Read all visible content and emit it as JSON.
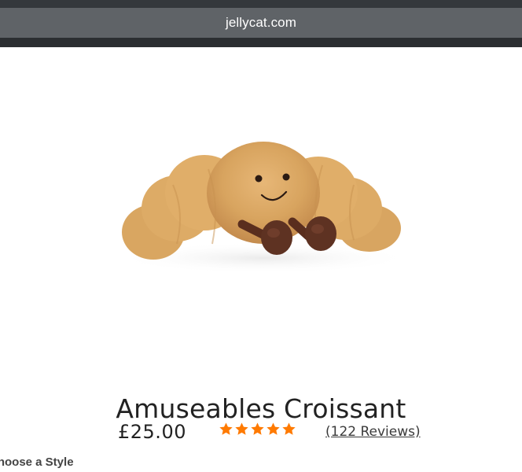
{
  "browser": {
    "url": "jellycat.com"
  },
  "product": {
    "image_alt": "Amuseables Croissant plush toy",
    "title": "Amuseables Croissant",
    "price": "£25.00",
    "rating": 5,
    "rating_max": 5,
    "reviews_label": "(122 Reviews)",
    "style_label": "Choose a Style"
  },
  "colors": {
    "star": "#ff7a00",
    "text": "#222222",
    "url_bar": "#5f6367",
    "browser_chrome": "#2f3336"
  }
}
